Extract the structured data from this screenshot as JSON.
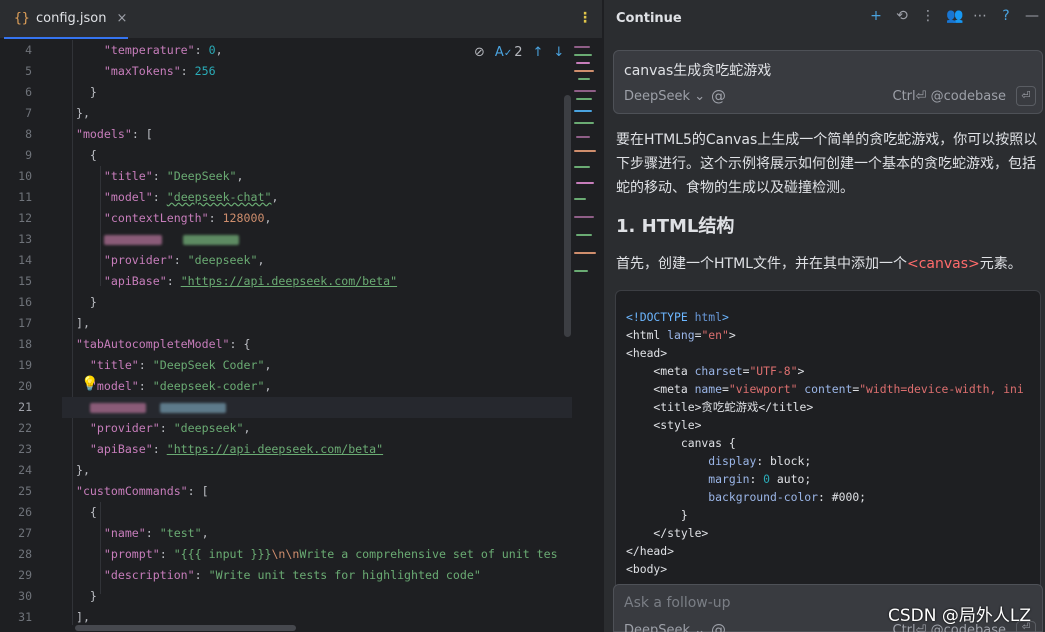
{
  "editor": {
    "tab": {
      "icon": "json-file-icon",
      "label": "config.json",
      "close": "×"
    },
    "inspection": {
      "count": "2"
    },
    "current_line": "21",
    "line_numbers": [
      "4",
      "5",
      "6",
      "7",
      "8",
      "9",
      "10",
      "11",
      "12",
      "13",
      "14",
      "15",
      "16",
      "17",
      "18",
      "19",
      "20",
      "21",
      "22",
      "23",
      "24",
      "25",
      "26",
      "27",
      "28",
      "29",
      "30",
      "31"
    ],
    "code": {
      "l4_key": "\"temperature\"",
      "l4_val": "0",
      "l5_key": "\"maxTokens\"",
      "l5_val": "256",
      "l8_key": "\"models\"",
      "l10_key": "\"title\"",
      "l10_val": "\"DeepSeek\"",
      "l11_key": "\"model\"",
      "l11_val": "\"deepseek-chat\"",
      "l12_key": "\"contextLength\"",
      "l12_val": "128000",
      "l14_key": "\"provider\"",
      "l14_val": "\"deepseek\"",
      "l15_key": "\"apiBase\"",
      "l15_val": "\"https://api.deepseek.com/beta\"",
      "l18_key": "\"tabAutocompleteModel\"",
      "l19_key": "\"title\"",
      "l19_val": "\"DeepSeek Coder\"",
      "l20_key": "\"model\"",
      "l20_val": "\"deepseek-coder\"",
      "l22_key": "\"provider\"",
      "l22_val": "\"deepseek\"",
      "l23_key": "\"apiBase\"",
      "l23_val": "\"https://api.deepseek.com/beta\"",
      "l25_key": "\"customCommands\"",
      "l27_key": "\"name\"",
      "l27_val": "\"test\"",
      "l28_key": "\"prompt\"",
      "l28_val_a": "\"{{{ input }}}",
      "l28_esc": "\\n\\n",
      "l28_val_b": "Write a comprehensive set of unit tes",
      "l29_key": "\"description\"",
      "l29_val": "\"Write unit tests for highlighted code\""
    }
  },
  "panel": {
    "title": "Continue",
    "query": "canvas生成贪吃蛇游戏",
    "model": "DeepSeek",
    "hint": "Ctrl⏎ @codebase",
    "answer_intro": "要在HTML5的Canvas上生成一个简单的贪吃蛇游戏，你可以按照以下步骤进行。这个示例将展示如何创建一个基本的贪吃蛇游戏，包括蛇的移动、食物的生成以及碰撞检测。",
    "section_heading": "1. HTML结构",
    "step_text_a": "首先，创建一个HTML文件，并在其中添加一个",
    "step_tag": "<canvas>",
    "step_text_b": "元素。",
    "code_lines": {
      "c1a": "<!DOCTYPE ",
      "c1b": "html",
      "c1c": ">",
      "c2a": "<html ",
      "c2b": "lang",
      "c2c": "=",
      "c2d": "\"en\"",
      "c2e": ">",
      "c3": "<head>",
      "c4a": "    <meta ",
      "c4b": "charset",
      "c4c": "=",
      "c4d": "\"UTF-8\"",
      "c4e": ">",
      "c5a": "    <meta ",
      "c5b": "name",
      "c5c": "=",
      "c5d": "\"viewport\"",
      "c5e": " content",
      "c5f": "=",
      "c5g": "\"width=device-width, ini",
      "c6": "    <title>贪吃蛇游戏</title>",
      "c7": "    <style>",
      "c8": "        canvas {",
      "c9a": "            display",
      "c9b": ": block;",
      "c10a": "            margin",
      "c10b": ": ",
      "c10c": "0",
      "c10d": " auto;",
      "c11a": "            background-color",
      "c11b": ": #000;",
      "c12": "        }",
      "c13": "    </style>",
      "c14": "</head>",
      "c15": "<body>"
    },
    "followup_placeholder": "Ask a follow-up",
    "followup_model": "DeepSeek",
    "followup_hint": "Ctrl⏎ @codebase"
  },
  "watermark": "CSDN @局外人LZ"
}
